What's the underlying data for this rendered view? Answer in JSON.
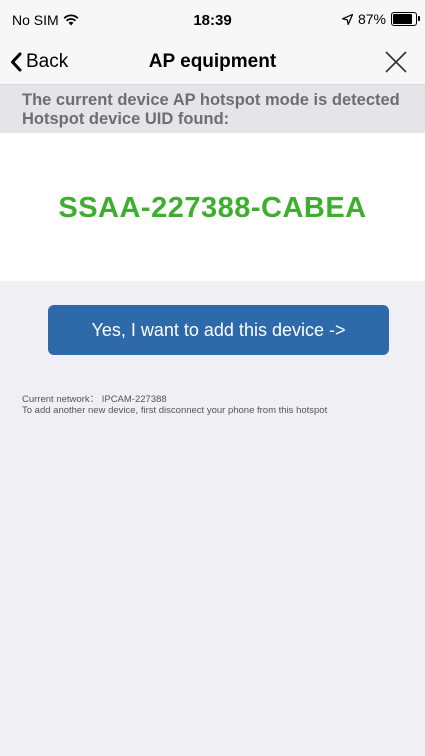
{
  "status_bar": {
    "carrier": "No SIM",
    "time": "18:39",
    "battery_percent": "87%",
    "battery_level": 0.87
  },
  "nav": {
    "back_label": "Back",
    "title": "AP equipment",
    "close_icon": "close-icon"
  },
  "message": {
    "line1": "The current device AP hotspot mode is detected",
    "line2": "Hotspot device UID found:"
  },
  "device": {
    "uid": "SSAA-227388-CABEA",
    "uid_color": "#3caf2d"
  },
  "action": {
    "add_label": "Yes, I want to add this device ->",
    "button_color": "#2e6aa9"
  },
  "network": {
    "current": "Current network： IPCAM-227388",
    "hint": "To add another new device, first disconnect your phone from this hotspot"
  }
}
